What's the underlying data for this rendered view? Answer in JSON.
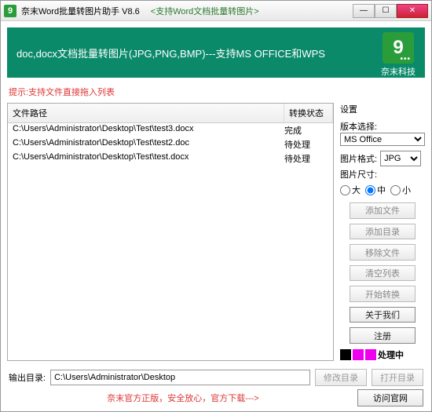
{
  "window": {
    "title": "奈末Word批量转图片助手 V8.6",
    "subtitle": "<支持Word文档批量转图片>"
  },
  "banner": {
    "text": "doc,docx文档批量转图片(JPG,PNG,BMP)---支持MS OFFICE和WPS",
    "brand": "奈末科技"
  },
  "hint": "提示:支持文件直接拖入列表",
  "list": {
    "head_path": "文件路径",
    "head_status": "转换状态",
    "rows": [
      {
        "path": "C:\\Users\\Administrator\\Desktop\\Test\\test3.docx",
        "status": "完成"
      },
      {
        "path": "C:\\Users\\Administrator\\Desktop\\Test\\test2.doc",
        "status": "待处理"
      },
      {
        "path": "C:\\Users\\Administrator\\Desktop\\Test\\test.docx",
        "status": "待处理"
      }
    ]
  },
  "settings": {
    "title": "设置",
    "version_label": "版本选择:",
    "version_value": "MS Office",
    "format_label": "图片格式:",
    "format_value": "JPG",
    "size_label": "图片尺寸:",
    "size_big": "大",
    "size_mid": "中",
    "size_small": "小"
  },
  "buttons": {
    "add_file": "添加文件",
    "add_dir": "添加目录",
    "remove": "移除文件",
    "clear": "清空列表",
    "start": "开始转换",
    "about": "关于我们",
    "register": "注册"
  },
  "legend": {
    "label": "处理中"
  },
  "output": {
    "label": "输出目录:",
    "path": "C:\\Users\\Administrator\\Desktop",
    "modify": "修改目录",
    "open": "打开目录"
  },
  "bottom": {
    "text": "奈末官方正版，安全放心，官方下载--->",
    "visit": "访问官网"
  }
}
